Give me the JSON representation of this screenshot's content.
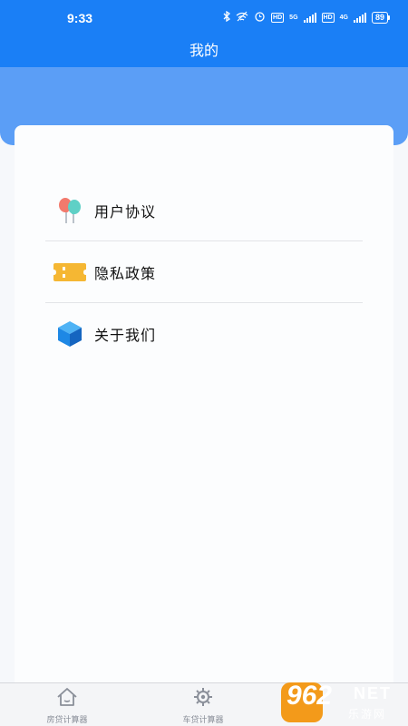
{
  "status_bar": {
    "time": "9:33",
    "network_5g": "5G",
    "network_4g": "4G",
    "hd_label": "HD",
    "battery": "89"
  },
  "header": {
    "title": "我的"
  },
  "menu": {
    "items": [
      {
        "label": "用户协议",
        "icon": "balloons-icon"
      },
      {
        "label": "隐私政策",
        "icon": "ticket-icon"
      },
      {
        "label": "关于我们",
        "icon": "cube-icon"
      }
    ]
  },
  "tab_bar": {
    "tabs": [
      {
        "label": "房贷计算器",
        "icon": "home-icon"
      },
      {
        "label": "车贷计算器",
        "icon": "gear-icon"
      }
    ]
  },
  "watermark": {
    "number": "962",
    "net": "NET",
    "site": "乐游网"
  },
  "colors": {
    "primary": "#1a7ff6",
    "header_band": "#5b9ef6",
    "ticket": "#f5b733",
    "cube": "#1e88e5",
    "watermark": "#f39a1a"
  }
}
